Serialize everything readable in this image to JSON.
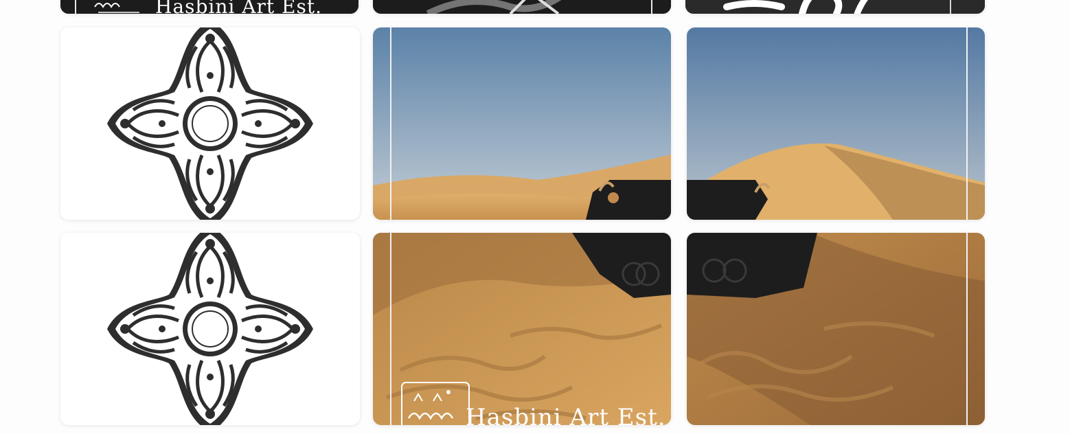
{
  "gallery": {
    "watermark": {
      "text": "Hasbini Art Est."
    },
    "tiles": [
      {
        "id": "top-left",
        "kind": "dark-artwork",
        "watermark": "Hasbini Art Est."
      },
      {
        "id": "top-middle",
        "kind": "dark-artwork"
      },
      {
        "id": "top-right",
        "kind": "dark-calligraphy"
      },
      {
        "id": "mid-left",
        "kind": "arabesque-pattern"
      },
      {
        "id": "mid-middle",
        "kind": "desert-photo-top-left"
      },
      {
        "id": "mid-right",
        "kind": "desert-photo-top-right"
      },
      {
        "id": "bottom-left",
        "kind": "arabesque-pattern"
      },
      {
        "id": "bottom-middle",
        "kind": "desert-photo-bottom-left",
        "watermark": "Hasbini Art Est."
      },
      {
        "id": "bottom-right",
        "kind": "desert-photo-bottom-right"
      }
    ]
  },
  "colors": {
    "sky_top": "#5b82a8",
    "sky_bottom": "#c3cdd5",
    "sand_light": "#e2b06c",
    "sand_dark": "#b07a3d",
    "ink": "#2a2a2a",
    "dark_tile": "#1c1c1c"
  }
}
